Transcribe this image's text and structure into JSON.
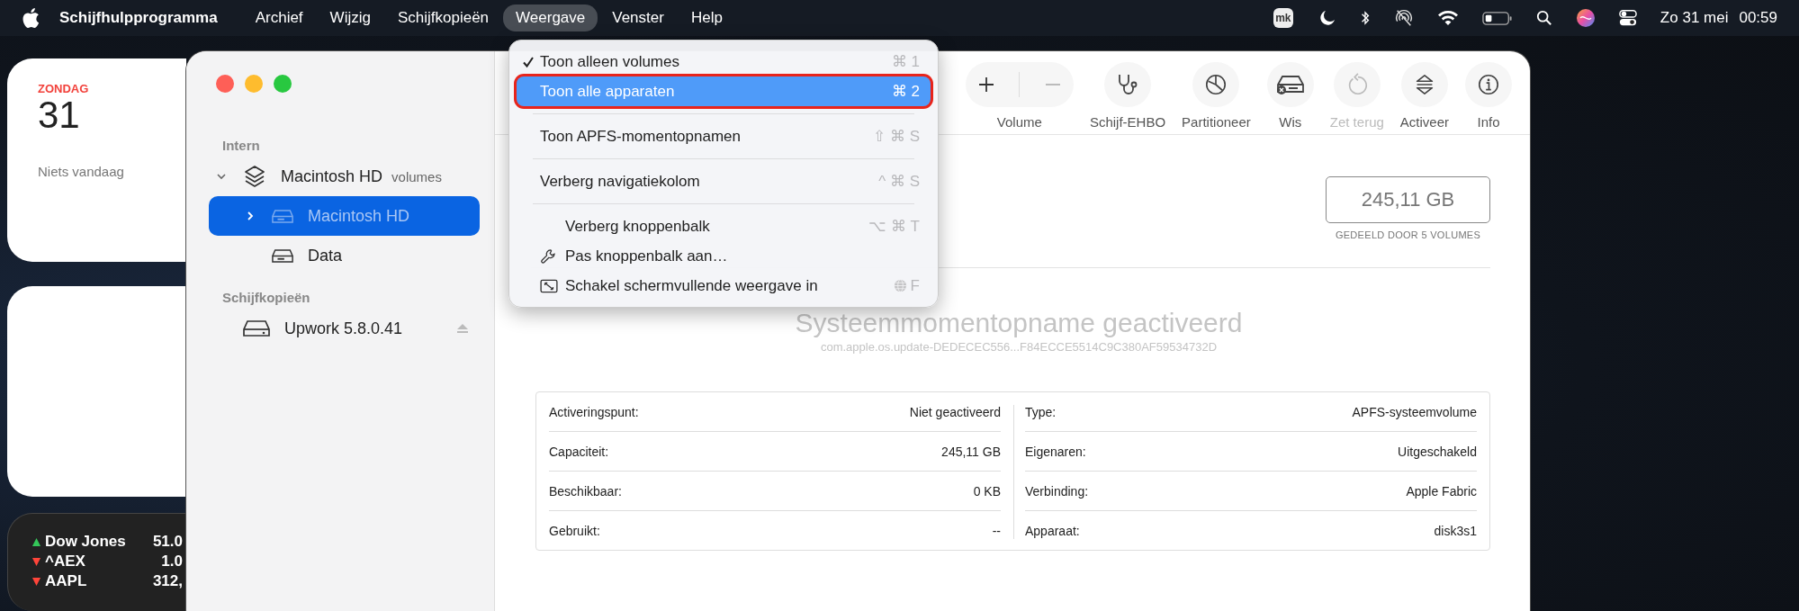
{
  "menu_bar": {
    "app_name": "Schijfhulpprogramma",
    "menus": [
      {
        "label": "Archief",
        "selected": false
      },
      {
        "label": "Wijzig",
        "selected": false
      },
      {
        "label": "Schijfkopieën",
        "selected": false
      },
      {
        "label": "Weergave",
        "selected": true
      },
      {
        "label": "Venster",
        "selected": false
      },
      {
        "label": "Help",
        "selected": false
      }
    ],
    "status_badge": "mk",
    "date": "Zo 31 mei",
    "time": "00:59"
  },
  "calendar_widget": {
    "weekday": "ZONDAG",
    "day": "31",
    "note": "Niets vandaag"
  },
  "stocks_widget": {
    "rows": [
      {
        "name": "Dow Jones",
        "value": "51.0",
        "kind": "up"
      },
      {
        "name": "^AEX",
        "value": "1.0",
        "kind": "down"
      },
      {
        "name": "AAPL",
        "value": "312,",
        "kind": "down"
      }
    ]
  },
  "sidebar": {
    "sections": [
      {
        "title": "Intern",
        "items": [
          {
            "kind": "stack",
            "label": "Macintosh HD",
            "note": "volumes",
            "expanded": true,
            "selected": false,
            "children": [
              {
                "kind": "volume",
                "label": "Macintosh HD",
                "expanded": false,
                "selected": true
              },
              {
                "kind": "volume",
                "label": "Data",
                "selected": false
              }
            ]
          }
        ]
      },
      {
        "title": "Schijfkopieën",
        "items": [
          {
            "kind": "image",
            "label": "Upwork 5.8.0.41",
            "selected": false
          }
        ]
      }
    ]
  },
  "toolbar": {
    "items": [
      {
        "kind": "volume",
        "label": "Volume",
        "disabled": false
      },
      {
        "kind": "firstaid",
        "label": "Schijf-EHBO",
        "disabled": false
      },
      {
        "kind": "partition",
        "label": "Partitioneer",
        "disabled": false
      },
      {
        "kind": "erase",
        "label": "Wis",
        "disabled": false
      },
      {
        "kind": "restore",
        "label": "Zet terug",
        "disabled": true
      },
      {
        "kind": "mount",
        "label": "Activeer",
        "disabled": false
      },
      {
        "kind": "info",
        "label": "Info",
        "disabled": false
      }
    ]
  },
  "capacity": {
    "value": "245,11 GB",
    "caption": "GEDEELD DOOR 5 VOLUMES"
  },
  "snapshot": {
    "title": "Systeemmomentopname geactiveerd",
    "identifier": "com.apple.os.update-DEDECEC556...F84ECCE5514C9C380AF59534732D"
  },
  "info_table": {
    "left": [
      {
        "label": "Activeringspunt:",
        "value": "Niet geactiveerd"
      },
      {
        "label": "Capaciteit:",
        "value": "245,11 GB"
      },
      {
        "label": "Beschikbaar:",
        "value": "0 KB"
      },
      {
        "label": "Gebruikt:",
        "value": "--"
      }
    ],
    "right": [
      {
        "label": "Type:",
        "value": "APFS-systeemvolume"
      },
      {
        "label": "Eigenaren:",
        "value": "Uitgeschakeld"
      },
      {
        "label": "Verbinding:",
        "value": "Apple Fabric"
      },
      {
        "label": "Apparaat:",
        "value": "disk3s1"
      }
    ]
  },
  "view_menu": {
    "items": [
      {
        "kind": "item",
        "label": "Toon alleen volumes",
        "shortcut": "⌘ 1",
        "checked": true,
        "selected": false
      },
      {
        "kind": "item",
        "label": "Toon alle apparaten",
        "shortcut": "⌘ 2",
        "checked": false,
        "selected": true
      },
      {
        "kind": "separator"
      },
      {
        "kind": "item",
        "label": "Toon APFS-momentopnamen",
        "shortcut": "⇧ ⌘ S",
        "checked": false,
        "selected": false
      },
      {
        "kind": "separator"
      },
      {
        "kind": "item",
        "label": "Verberg navigatiekolom",
        "shortcut": "^ ⌘ S",
        "checked": false,
        "selected": false
      },
      {
        "kind": "separator"
      },
      {
        "kind": "indented",
        "label": "Verberg knoppenbalk",
        "shortcut": "⌥ ⌘ T",
        "checked": false,
        "selected": false
      },
      {
        "kind": "wrench",
        "label": "Pas knoppenbalk aan…",
        "checked": false,
        "selected": false
      },
      {
        "kind": "fullscreen",
        "label": "Schakel schermvullende weergave in",
        "shortcut": "F",
        "checked": false,
        "selected": false
      }
    ]
  }
}
